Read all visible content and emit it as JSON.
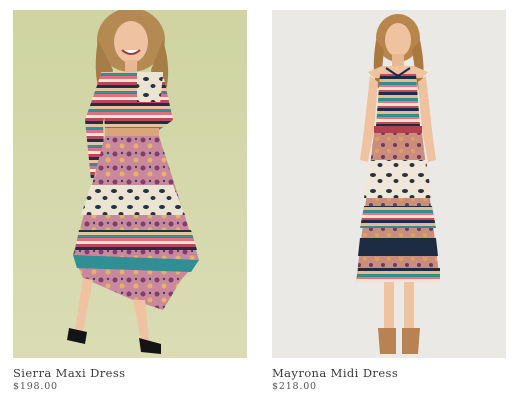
{
  "products": [
    {
      "name": "Sierra Maxi Dress",
      "price": "$198.00",
      "image_bg": "#d2d6a6"
    },
    {
      "name": "Mayrona Midi Dress",
      "price": "$218.00",
      "image_bg": "#ebe9e6"
    }
  ]
}
